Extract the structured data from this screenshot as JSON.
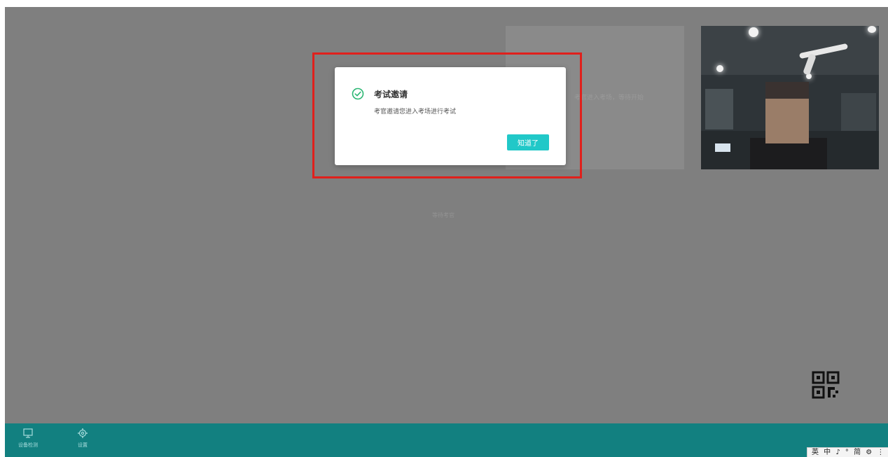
{
  "dialog": {
    "title": "考试邀请",
    "message": "考官邀请您进入考场进行考试",
    "ok_label": "知道了",
    "accent_color": "#21c8c8",
    "icon": "check-circle-icon"
  },
  "remote_video": {
    "status_text": "考官进入考场，等待开始"
  },
  "center_hint": "等待考官",
  "qr_button": {
    "icon": "qr-code-icon"
  },
  "footer": {
    "background": "#128080",
    "items": [
      {
        "label": "设备检测",
        "icon": "monitor-icon"
      },
      {
        "label": "设置",
        "icon": "gear-icon"
      }
    ]
  },
  "ime_toolbar": {
    "text": "英 中 ♪ ° 简 ⚙ ⋮"
  },
  "highlight_color": "#e0201c"
}
